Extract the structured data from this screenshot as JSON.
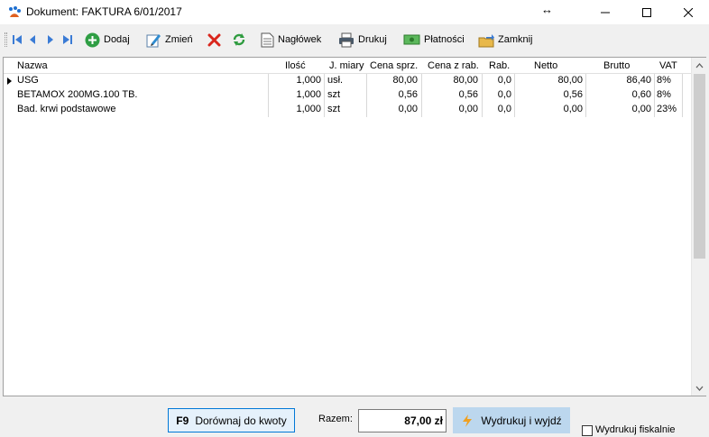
{
  "window": {
    "title": "Dokument: FAKTURA 6/01/2017"
  },
  "toolbar": {
    "add_label": "Dodaj",
    "edit_label": "Zmień",
    "header_label": "Nagłówek",
    "print_label": "Drukuj",
    "payments_label": "Płatności",
    "close_label": "Zamknij"
  },
  "grid": {
    "columns": [
      "Nazwa",
      "Ilość",
      "J. miary",
      "Cena sprz.",
      "Cena z rab.",
      "Rab.",
      "Netto",
      "Brutto",
      "VAT"
    ],
    "rows": [
      [
        "USG",
        "1,000",
        "usł.",
        "80,00",
        "80,00",
        "0,0",
        "80,00",
        "86,40",
        "8%"
      ],
      [
        "BETAMOX 200MG.100 TB.",
        "1,000",
        "szt",
        "0,56",
        "0,56",
        "0,0",
        "0,56",
        "0,60",
        "8%"
      ],
      [
        "Bad. krwi podstawowe",
        "1,000",
        "szt",
        "0,00",
        "0,00",
        "0,0",
        "0,00",
        "0,00",
        "23%"
      ]
    ]
  },
  "footer": {
    "f9_key": "F9",
    "f9_label": "Dorównaj do kwoty",
    "total_label": "Razem:",
    "total_value": "87,00 zł",
    "print_exit_label": "Wydrukuj i wyjdź",
    "fiscal_label": "Wydrukuj fiskalnie"
  },
  "colors": {
    "accent_blue": "#0078d7",
    "button_highlight": "#bcd7ee",
    "delete_red": "#d9261c",
    "refresh_green": "#2e9b3f",
    "add_green": "#2f9e44"
  }
}
